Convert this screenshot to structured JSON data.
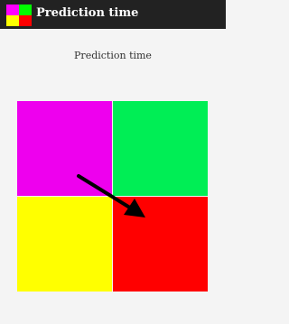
{
  "app_bar": {
    "title": "Prediction time",
    "icon": "four-color-square-icon",
    "icon_colors": [
      "#ff00ff",
      "#00ff00",
      "#ffff00",
      "#ff0000"
    ],
    "background": "#222222"
  },
  "main": {
    "heading": "Prediction time"
  },
  "grid": {
    "quadrants": [
      {
        "name": "magenta",
        "color": "#ee00ee"
      },
      {
        "name": "green",
        "color": "#00ee55"
      },
      {
        "name": "yellow",
        "color": "#ffff00"
      },
      {
        "name": "red",
        "color": "#ff0000"
      }
    ],
    "arrow": {
      "icon": "arrow-down-right-icon",
      "color": "#000000",
      "points_to": "red"
    }
  }
}
